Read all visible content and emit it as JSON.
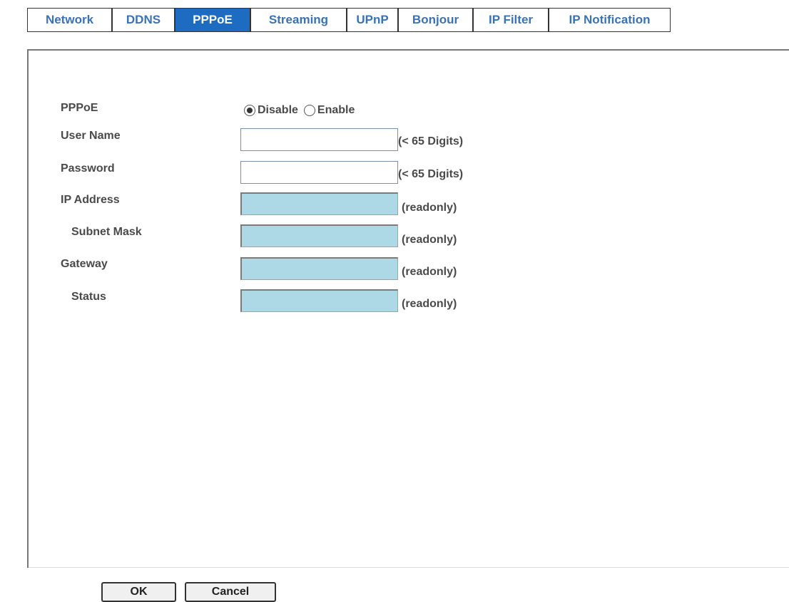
{
  "tabs": [
    {
      "label": "Network",
      "active": false
    },
    {
      "label": "DDNS",
      "active": false
    },
    {
      "label": "PPPoE",
      "active": true
    },
    {
      "label": "Streaming",
      "active": false
    },
    {
      "label": "UPnP",
      "active": false
    },
    {
      "label": "Bonjour",
      "active": false
    },
    {
      "label": "IP Filter",
      "active": false
    },
    {
      "label": "IP Notification",
      "active": false
    }
  ],
  "form": {
    "pppoe": {
      "label": "PPPoE",
      "options": [
        {
          "label": "Disable",
          "selected": true
        },
        {
          "label": "Enable",
          "selected": false
        }
      ]
    },
    "user_name": {
      "label": "User Name",
      "value": "",
      "hint": "(< 65 Digits)"
    },
    "password": {
      "label": "Password",
      "value": "",
      "hint": "(< 65 Digits)"
    },
    "ip_address": {
      "label": "IP Address",
      "value": "",
      "hint": "(readonly)"
    },
    "subnet_mask": {
      "label": "Subnet Mask",
      "value": "",
      "hint": "(readonly)"
    },
    "gateway": {
      "label": "Gateway",
      "value": "",
      "hint": "(readonly)"
    },
    "status": {
      "label": "Status",
      "value": "",
      "hint": "(readonly)"
    }
  },
  "buttons": {
    "ok": "OK",
    "cancel": "Cancel"
  },
  "colors": {
    "active_tab": "#1d6cc2",
    "tab_text": "#3a72b8",
    "readonly_field": "#add8e6"
  }
}
